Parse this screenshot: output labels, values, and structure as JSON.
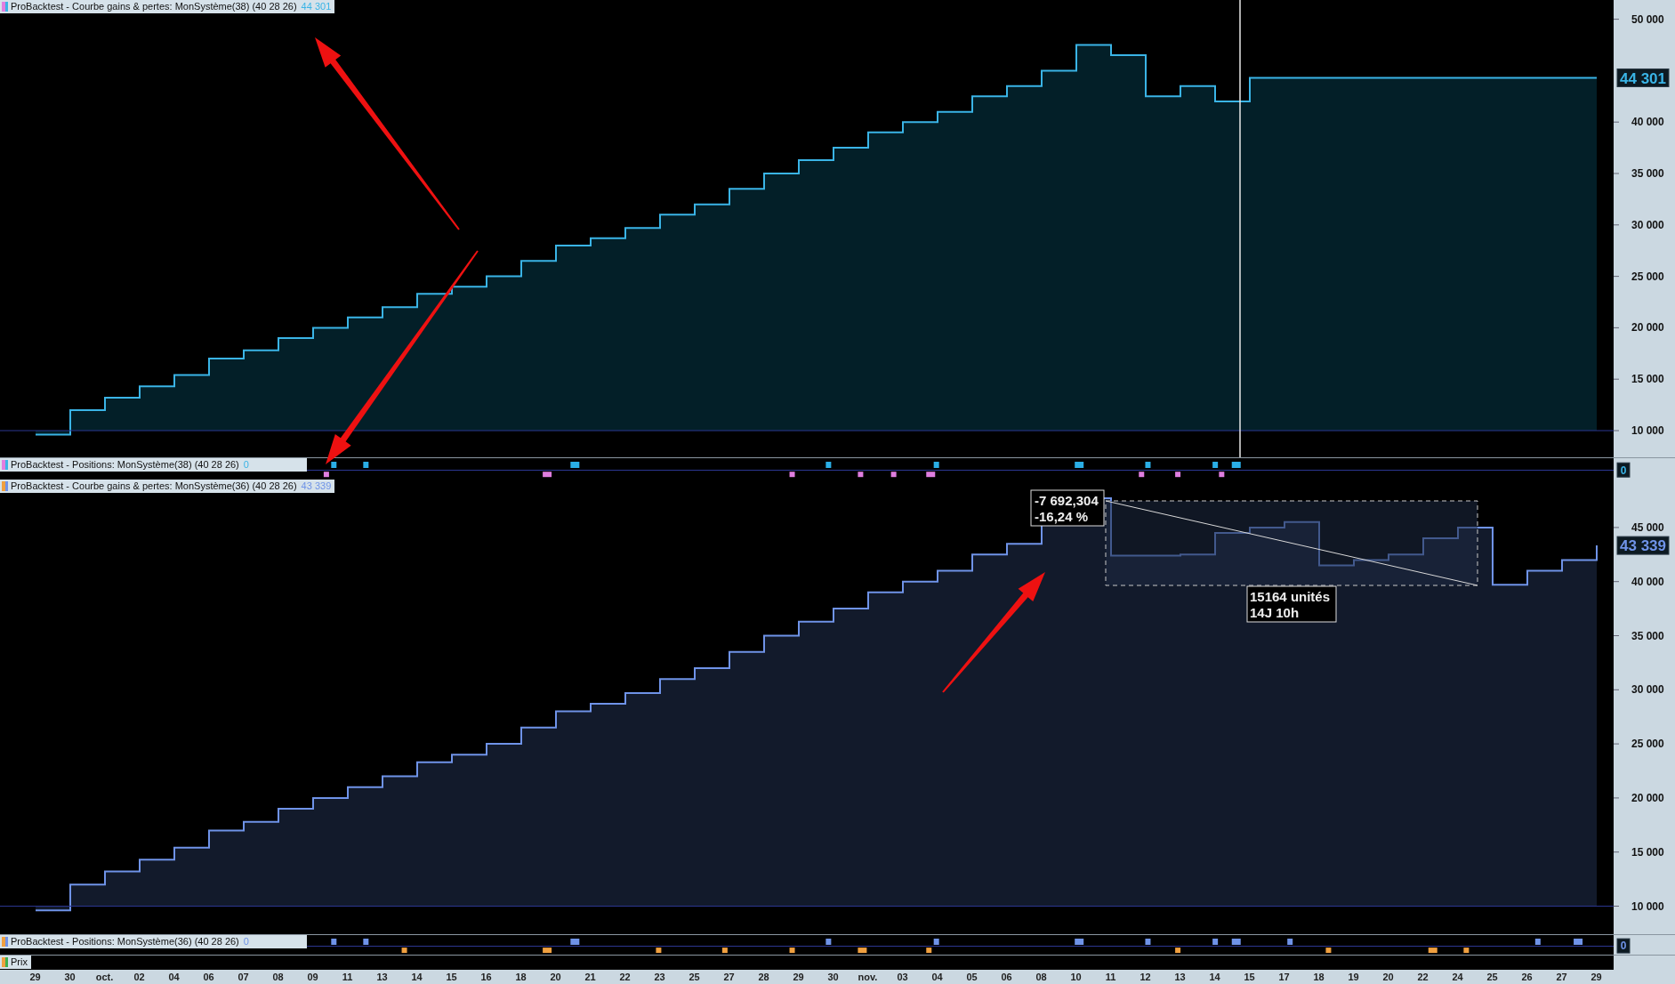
{
  "panels": [
    {
      "kind": "equity",
      "title": "ProBacktest - Courbe gains & pertes: MonSystème(38) (40 28 26)",
      "value": "44 301",
      "price_tag": "44 301",
      "y_labels": [
        "50 000",
        "40 000",
        "35 000",
        "30 000",
        "25 000",
        "20 000",
        "15 000",
        "10 000"
      ]
    },
    {
      "kind": "positions",
      "title": "ProBacktest - Positions: MonSystème(38) (40 28 26)",
      "value": "0",
      "price_tag": "0"
    },
    {
      "kind": "equity",
      "title": "ProBacktest - Courbe gains & pertes: MonSystème(36) (40 28 26)",
      "value": "43 339",
      "price_tag": "43 339",
      "drawdown": {
        "amount": "-7 692,304",
        "percent": "-16,24 %",
        "units": "15164 unités",
        "duration": "14J 10h"
      },
      "y_labels": [
        "45 000",
        "40 000",
        "35 000",
        "30 000",
        "25 000",
        "20 000",
        "15 000",
        "10 000"
      ]
    },
    {
      "kind": "positions",
      "title": "ProBacktest - Positions: MonSystème(36) (40 28 26)",
      "value": "0",
      "price_tag": "0"
    },
    {
      "kind": "price",
      "title": "Prix"
    }
  ],
  "x_axis": {
    "labels": [
      "29",
      "30",
      "oct.",
      "02",
      "04",
      "06",
      "07",
      "08",
      "09",
      "11",
      "13",
      "14",
      "15",
      "16",
      "18",
      "20",
      "21",
      "22",
      "23",
      "25",
      "27",
      "28",
      "29",
      "30",
      "nov.",
      "03",
      "04",
      "05",
      "06",
      "08",
      "10",
      "11",
      "12",
      "13",
      "14",
      "15",
      "17",
      "18",
      "19",
      "20",
      "22",
      "24",
      "25",
      "26",
      "27",
      "29"
    ]
  }
}
